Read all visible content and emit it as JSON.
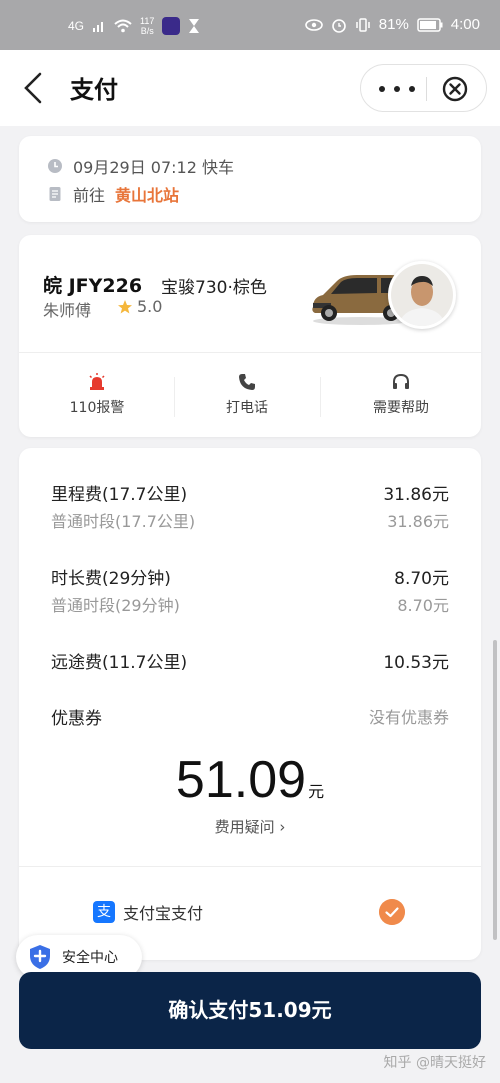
{
  "status_bar": {
    "network": "4G",
    "speed_value": "117",
    "speed_unit": "B/s",
    "battery": "81%",
    "time": "4:00",
    "left_icons": [
      "signal-icon",
      "wifi-icon",
      "app-icon",
      "hourglass-icon"
    ],
    "right_icons": [
      "eye-icon",
      "alarm-icon",
      "vibrate-icon",
      "battery-icon"
    ]
  },
  "nav": {
    "title": "支付",
    "back_icon": "back-chevron-icon",
    "more_icon": "more-dots-icon",
    "close_icon": "close-circle-icon"
  },
  "trip": {
    "datetime_type": "09月29日 07:12 快车",
    "dest_prefix": "前往",
    "destination": "黄山北站"
  },
  "driver": {
    "plate": "皖 JFY226",
    "car_model": "宝骏730·棕色",
    "name": "朱师傅",
    "rating": "5.0"
  },
  "actions": [
    {
      "label": "110报警",
      "icon": "alarm-siren-icon"
    },
    {
      "label": "打电话",
      "icon": "phone-icon"
    },
    {
      "label": "需要帮助",
      "icon": "headset-icon"
    }
  ],
  "fees": {
    "mileage_label": "里程费(17.7公里)",
    "mileage_value": "31.86元",
    "mileage_sub_label": "普通时段(17.7公里)",
    "mileage_sub_value": "31.86元",
    "duration_label": "时长费(29分钟)",
    "duration_value": "8.70元",
    "duration_sub_label": "普通时段(29分钟)",
    "duration_sub_value": "8.70元",
    "longdist_label": "远途费(11.7公里)",
    "longdist_value": "10.53元",
    "coupon_label": "优惠券",
    "coupon_value": "没有优惠券"
  },
  "total": {
    "amount": "51.09",
    "unit": "元",
    "doubt": "费用疑问 ›"
  },
  "payment": {
    "method": "支付宝支付",
    "alipay_glyph": "支",
    "selected": true
  },
  "safety_center": "安全中心",
  "confirm_button": "确认支付51.09元",
  "watermark": "知乎 @晴天挺好",
  "colors": {
    "accent_orange": "#e8753a",
    "confirm_navy": "#0b2548",
    "alipay_blue": "#1677ff"
  }
}
